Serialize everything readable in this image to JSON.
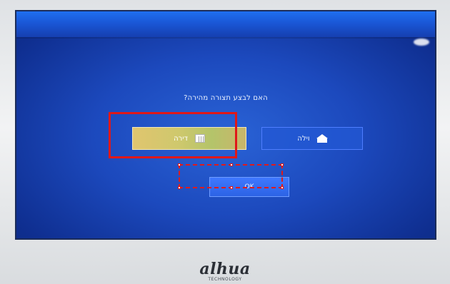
{
  "dialog": {
    "prompt": "?האם לבצע תצורה מהירה",
    "options": [
      {
        "label": "דירה",
        "icon": "building-icon"
      },
      {
        "label": "וילה",
        "icon": "house-icon"
      }
    ],
    "ok_label": "OK"
  },
  "brand": {
    "logo_text": "alhua",
    "logo_tagline": "TECHNOLOGY"
  },
  "annotations": {
    "highlight_color": "#e01818"
  },
  "colors": {
    "screen_blue": "#1c49bd",
    "top_bar_blue": "#1a57d6",
    "selected_option": "#d2c86c"
  }
}
